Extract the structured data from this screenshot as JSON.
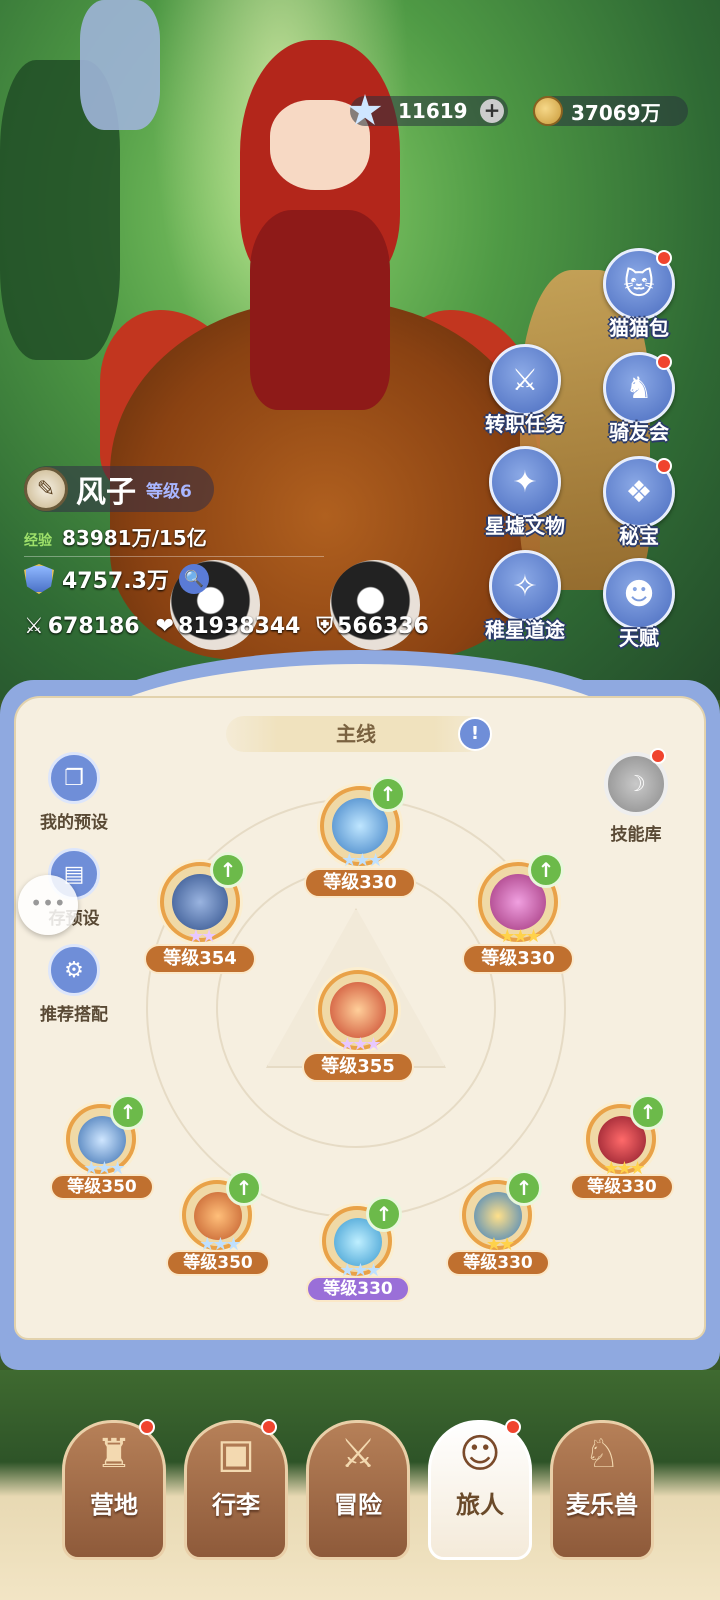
{
  "currencies": {
    "stars": "11619",
    "gold": "37069万"
  },
  "features": [
    {
      "label": "猫猫包",
      "badge": true,
      "icon": "cat-bag-icon"
    },
    {
      "label": "转职任务",
      "badge": false,
      "icon": "job-change-icon"
    },
    {
      "label": "骑友会",
      "badge": true,
      "icon": "horse-icon"
    },
    {
      "label": "星墟文物",
      "badge": false,
      "icon": "relic-icon"
    },
    {
      "label": "秘宝",
      "badge": true,
      "icon": "treasure-icon"
    },
    {
      "label": "稚星道途",
      "badge": false,
      "icon": "path-icon"
    },
    {
      "label": "天赋",
      "badge": false,
      "icon": "talent-icon"
    }
  ],
  "player": {
    "name": "风子",
    "level": "等级6",
    "exp_label": "经验",
    "exp_value": "83981万/15亿",
    "power": "4757.3万",
    "attack": "678186",
    "hp": "81938344",
    "defense": "566336"
  },
  "panel": {
    "tab": "主线",
    "side_buttons": [
      "我的预设",
      "存预设",
      "推荐搭配"
    ],
    "library": "技能库"
  },
  "skills": [
    {
      "level": "等级330",
      "stars": "★★★",
      "star_color": "#bfe0ff",
      "upgrade": true,
      "color": "#3d7fc4"
    },
    {
      "level": "等级354",
      "stars": "★★",
      "star_color": "#e8c8ff",
      "upgrade": true,
      "color": "#2f4f8a"
    },
    {
      "level": "等级330",
      "stars": "★★★",
      "star_color": "#ffd24a",
      "upgrade": true,
      "color": "#a0337a"
    },
    {
      "level": "等级355",
      "stars": "★★★",
      "star_color": "#e8c8ff",
      "upgrade": false,
      "color": "#c8432a"
    },
    {
      "level": "等级350",
      "stars": "★★★",
      "star_color": "#bfe0ff",
      "upgrade": true,
      "color": "#3a6fb0"
    },
    {
      "level": "等级350",
      "stars": "★★★",
      "star_color": "#bfe0ff",
      "upgrade": true,
      "color": "#c05a2a"
    },
    {
      "level": "等级330",
      "stars": "★★★",
      "star_color": "#bfe0ff",
      "upgrade": true,
      "color": "#3a9ad0"
    },
    {
      "level": "等级330",
      "stars": "★★",
      "star_color": "#ffd24a",
      "upgrade": true,
      "color": "#3a7fc0"
    },
    {
      "level": "等级330",
      "stars": "★★★",
      "star_color": "#ffd24a",
      "upgrade": true,
      "color": "#8a1a2a"
    }
  ],
  "nav": [
    {
      "label": "营地",
      "icon": "castle-icon",
      "badge": true,
      "active": false
    },
    {
      "label": "行李",
      "icon": "chest-icon",
      "badge": true,
      "active": false
    },
    {
      "label": "冒险",
      "icon": "swords-icon",
      "badge": false,
      "active": false
    },
    {
      "label": "旅人",
      "icon": "traveler-icon",
      "badge": true,
      "active": true
    },
    {
      "label": "麦乐兽",
      "icon": "beast-icon",
      "badge": false,
      "active": false
    }
  ]
}
